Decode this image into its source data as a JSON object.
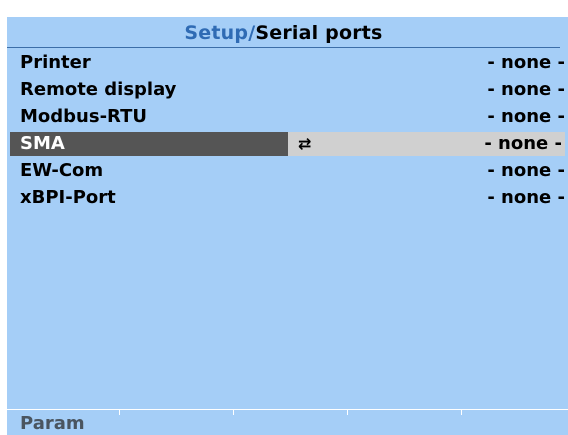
{
  "header": {
    "path": "Setup",
    "separator": "/",
    "current": "Serial ports"
  },
  "ports": [
    {
      "label": "Printer",
      "value": "- none -"
    },
    {
      "label": "Remote display",
      "value": "- none -"
    },
    {
      "label": "Modbus-RTU",
      "value": "- none -"
    },
    {
      "label": "SMA",
      "value": "- none -",
      "selected": true
    },
    {
      "label": "EW-Com",
      "value": "- none -"
    },
    {
      "label": "xBPI-Port",
      "value": "- none -"
    }
  ],
  "swap_icon": "⇄",
  "softkeys": [
    "Param",
    "",
    "",
    "",
    ""
  ],
  "colors": {
    "screen_bg": "#a5cef7",
    "title_path": "#2f6bb4",
    "selected_label_bg": "#555555",
    "selected_value_bg": "#d0d0d0"
  }
}
